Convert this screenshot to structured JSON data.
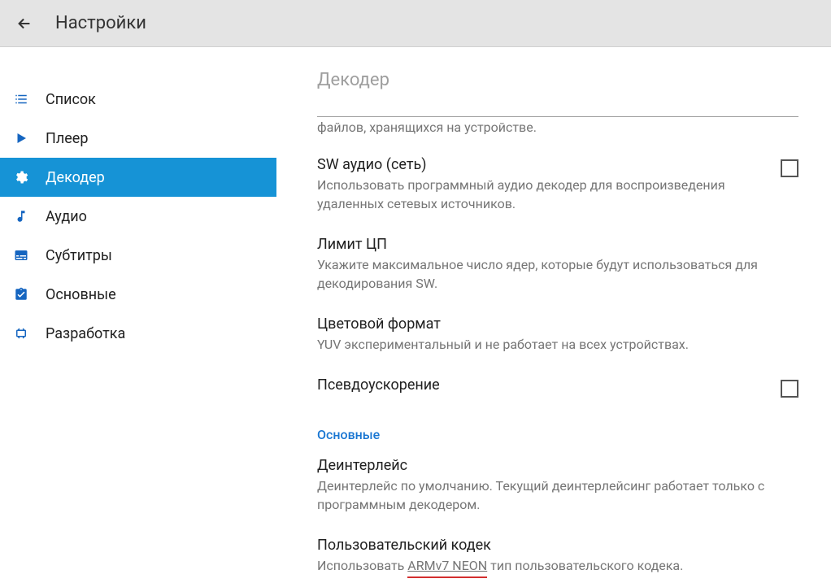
{
  "toolbar": {
    "title": "Настройки"
  },
  "sidebar": {
    "items": [
      {
        "label": "Список"
      },
      {
        "label": "Плеер"
      },
      {
        "label": "Декодер"
      },
      {
        "label": "Аудио"
      },
      {
        "label": "Субтитры"
      },
      {
        "label": "Основные"
      },
      {
        "label": "Разработка"
      }
    ]
  },
  "main": {
    "section_header": "Декодер",
    "cutoff_desc": "файлов, хранящихся на устройстве.",
    "sw_audio": {
      "title": "SW аудио (сеть)",
      "desc": "Использовать программный аудио декодер для воспроизведения удаленных сетевых источников."
    },
    "cpu_limit": {
      "title": "Лимит ЦП",
      "desc": "Укажите максимальное число ядер, которые будут использоваться для декодирования SW."
    },
    "color_format": {
      "title": "Цветовой формат",
      "desc": "YUV экспериментальный и не работает на всех устройствах."
    },
    "pseudo_accel": {
      "title": "Псевдоускорение"
    },
    "group_main": "Основные",
    "deinterlace": {
      "title": "Деинтерлейс",
      "desc": "Деинтерлейс по умолчанию. Текущий деинтерлейсинг работает только с программным декодером."
    },
    "codec": {
      "title": "Пользовательский кодек",
      "desc_prefix": "Использовать ",
      "desc_codec": "ARMv7 NEON",
      "desc_suffix": " тип пользовательского кодека."
    }
  }
}
